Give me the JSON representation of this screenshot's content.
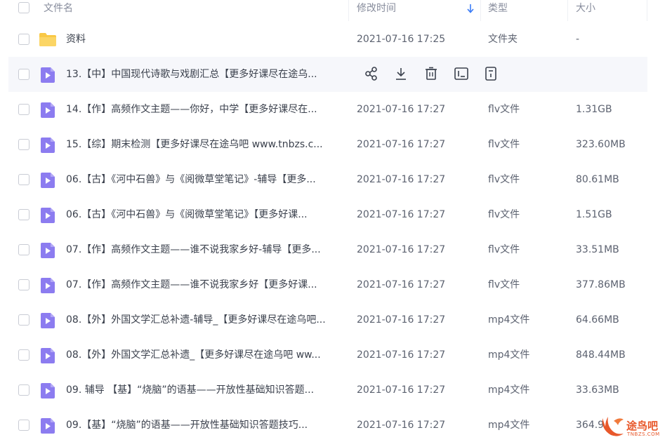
{
  "header": {
    "name_label": "文件名",
    "modified_label": "修改时间",
    "type_label": "类型",
    "size_label": "大小"
  },
  "colors": {
    "folder": "#f9c846",
    "file_icon": "#8c7cf0",
    "hover_row": "#f6f7fb",
    "sort_arrow": "#3a7bf6",
    "watermark": "#e8582b"
  },
  "rows": [
    {
      "name": "资料",
      "time": "2021-07-16 17:25",
      "type": "文件夹",
      "size": "-",
      "icon": "folder-icon"
    },
    {
      "name": "13.【中】中国现代诗歌与戏剧汇总【更多好课尽在途乌...",
      "time": "",
      "type": "",
      "size": "",
      "icon": "video-file-icon"
    },
    {
      "name": "14.【作】高频作文主题——你好，中学【更多好课尽在...",
      "time": "2021-07-16 17:27",
      "type": "flv文件",
      "size": "1.31GB",
      "icon": "video-file-icon"
    },
    {
      "name": "15.【综】期末检测【更多好课尽在途乌吧 www.tnbzs.c...",
      "time": "2021-07-16 17:27",
      "type": "flv文件",
      "size": "323.60MB",
      "icon": "video-file-icon"
    },
    {
      "name": "06.【古】《河中石兽》与《阅微草堂笔记》-辅导【更多...",
      "time": "2021-07-16 17:27",
      "type": "flv文件",
      "size": "80.61MB",
      "icon": "video-file-icon"
    },
    {
      "name": "06.【古】《河中石兽》与《阅微草堂笔记》【更多好课...",
      "time": "2021-07-16 17:27",
      "type": "flv文件",
      "size": "1.51GB",
      "icon": "video-file-icon"
    },
    {
      "name": "07.【作】高频作文主题——谁不说我家乡好-辅导【更多...",
      "time": "2021-07-16 17:27",
      "type": "flv文件",
      "size": "33.51MB",
      "icon": "video-file-icon"
    },
    {
      "name": "07.【作】高频作文主题——谁不说我家乡好【更多好课...",
      "time": "2021-07-16 17:27",
      "type": "flv文件",
      "size": "377.86MB",
      "icon": "video-file-icon"
    },
    {
      "name": "08.【外】外国文学汇总补遗-辅导_【更多好课尽在途乌吧...",
      "time": "2021-07-16 17:27",
      "type": "mp4文件",
      "size": "64.66MB",
      "icon": "video-file-icon"
    },
    {
      "name": "08.【外】外国文学汇总补遗_【更多好课尽在途乌吧 ww...",
      "time": "2021-07-16 17:27",
      "type": "mp4文件",
      "size": "848.44MB",
      "icon": "video-file-icon"
    },
    {
      "name": "09. 辅导 【基】“烧脑”的语基——开放性基础知识答题...",
      "time": "2021-07-16 17:27",
      "type": "mp4文件",
      "size": "33.63MB",
      "icon": "video-file-icon"
    },
    {
      "name": "09.【基】“烧脑”的语基——开放性基础知识答题技巧...",
      "time": "2021-07-16 17:27",
      "type": "mp4文件",
      "size": "364.9",
      "icon": "video-file-icon"
    }
  ],
  "hover_actions": [
    "share-icon",
    "download-icon",
    "delete-icon",
    "rename-icon",
    "more-icon"
  ],
  "watermark": {
    "text": "途鸟吧",
    "sub": "TNBZS.COM"
  }
}
